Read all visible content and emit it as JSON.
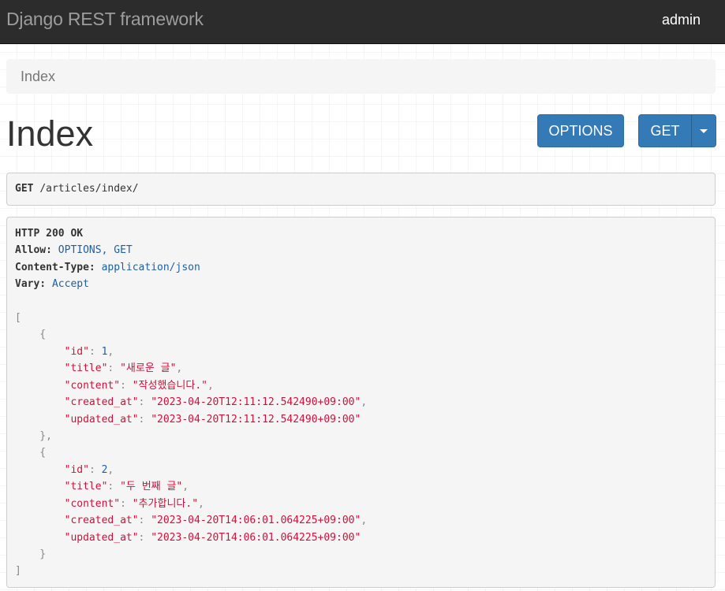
{
  "navbar": {
    "brand": "Django REST framework",
    "user": "admin"
  },
  "breadcrumb": {
    "items": [
      {
        "label": "Index"
      }
    ]
  },
  "page_title": "Index",
  "buttons": {
    "options_label": "OPTIONS",
    "get_label": "GET"
  },
  "request": {
    "method": "GET",
    "path": "/articles/index/"
  },
  "response": {
    "status": "HTTP 200 OK",
    "headers": [
      {
        "name": "Allow:",
        "value": "OPTIONS, GET"
      },
      {
        "name": "Content-Type:",
        "value": "application/json"
      },
      {
        "name": "Vary:",
        "value": "Accept"
      }
    ],
    "body": [
      {
        "id": "1",
        "title": "\"새로운 글\"",
        "content": "\"작성했습니다.\"",
        "created_at": "\"2023-04-20T12:11:12.542490+09:00\"",
        "updated_at": "\"2023-04-20T12:11:12.542490+09:00\""
      },
      {
        "id": "2",
        "title": "\"두 번째 글\"",
        "content": "\"추가합니다.\"",
        "created_at": "\"2023-04-20T14:06:01.064225+09:00\"",
        "updated_at": "\"2023-04-20T14:06:01.064225+09:00\""
      }
    ],
    "keys": {
      "id": "\"id\"",
      "title": "\"title\"",
      "content": "\"content\"",
      "created_at": "\"created_at\"",
      "updated_at": "\"updated_at\""
    }
  },
  "colors": {
    "navbar_bg": "#2c2c2c",
    "button_primary": "#337ab7",
    "json_string": "#d0103a",
    "json_number": "#1f5f9e",
    "header_value": "#1f5f9e"
  },
  "icons": {
    "dropdown": "caret-down-icon"
  }
}
